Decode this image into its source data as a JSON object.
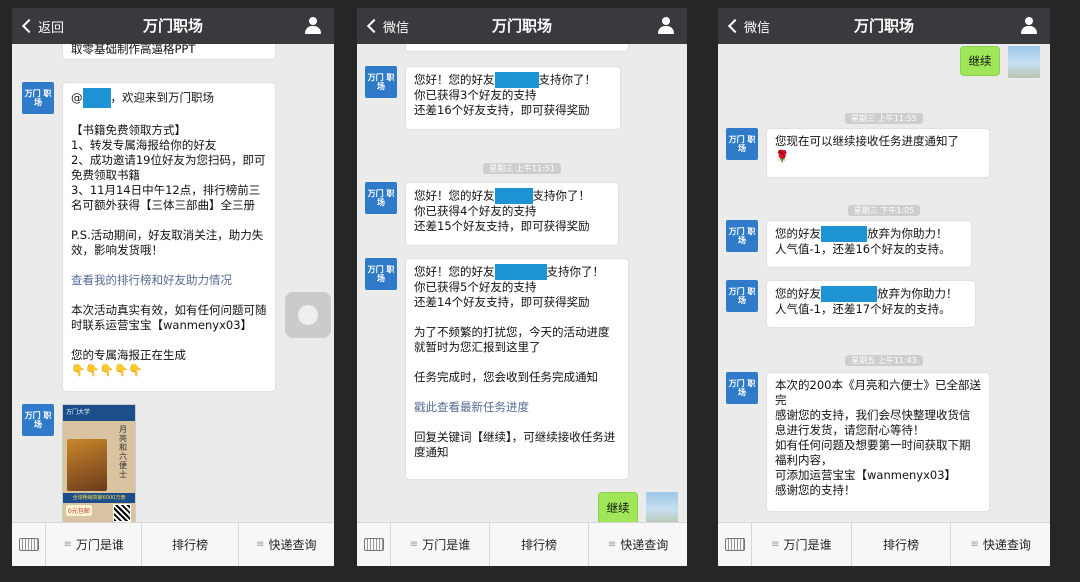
{
  "screens": [
    {
      "back_label": "返回",
      "title": "万门职场",
      "avatar_text": "万门 职场",
      "top_line": "取零基础制作高逼格PPT",
      "welcome_prefix": "@",
      "welcome_suffix": "，欢迎来到万门职场",
      "rules": "【书籍免费领取方式】\n1、转发专属海报给你的好友\n2、成功邀请19位好友为您扫码，即可免费领取书籍\n3、11月14日中午12点，排行榜前三名可额外获得【三体三部曲】全三册\n\nP.S.活动期间，好友取消关注，助力失效，影响发货哦！",
      "rank_link": "查看我的排行榜和好友助力情况",
      "contact": "本次活动真实有效，如有任何问题可随时联系运营宝宝【wanmenyx03】",
      "poster_generating": "您的专属海报正在生成",
      "emoji_row": "👇👇👇👇👇",
      "poster": {
        "brand": "万门大学",
        "book_title": "月亮和六便士",
        "badge": "全球畅销突破6000万册",
        "price": "0元包邮"
      }
    },
    {
      "back_label": "微信",
      "title": "万门职场",
      "avatar_text": "万门 职场",
      "msg1_prefix": "您好！您的好友",
      "msg1_suffix": "支持你了！",
      "msg1_rest": "你已获得3个好友的支持\n还差16个好友支持，即可获得奖励",
      "timestamp": "星期三 上午11:51",
      "msg2_prefix": "您好！您的好友",
      "msg2_suffix": "支持你了！",
      "msg2_rest": "你已获得4个好友的支持\n还差15个好友支持，即可获得奖励",
      "msg3_prefix": "您好！您的好友",
      "msg3_suffix": "支持你了！",
      "msg3_rest": "你已获得5个好友的支持\n还差14个好友支持，即可获得奖励\n\n为了不频繁的打扰您，今天的活动进度就暂时为您汇报到这里了\n\n任务完成时，您会收到任务完成通知",
      "progress_link": "戳此查看最新任务进度",
      "keyword_hint": "回复关键词【继续】，可继续接收任务进度通知",
      "user_msg": "继续"
    },
    {
      "back_label": "微信",
      "title": "万门职场",
      "avatar_text": "万门 职场",
      "user_msg": "继续",
      "ts1": "星期三 上午11:55",
      "msg1": "您现在可以继续接收任务进度通知了",
      "msg1_emoji": "🌹",
      "ts2": "星期三 下午1:05",
      "msg2_prefix": "您的好友",
      "msg2_suffix": "放弃为你助力！",
      "msg2_rest": "人气值-1，还差16个好友的支持。",
      "msg3_prefix": "您的好友",
      "msg3_suffix": "放弃为你助力！",
      "msg3_rest": "人气值-1，还差17个好友的支持。",
      "ts3": "星期五 上午11:43",
      "msg4": "本次的200本《月亮和六便士》已全部送完\n感谢您的支持，我们会尽快整理收货信息进行发货，请您耐心等待！\n如有任何问题及想要第一时间获取下期福利内容，\n可添加运营宝宝【wanmenyx03】\n感谢您的支持！"
    }
  ],
  "toolbar": {
    "item1": "万门是谁",
    "item2": "排行榜",
    "item3": "快递查询"
  },
  "colors": {
    "navbar": "#3a3a3e",
    "chat_bg": "#ebebeb",
    "avatar": "#2f7bc9",
    "user_bubble": "#9fe658",
    "link": "#576b95",
    "redaction": "#1e93d4"
  },
  "icons": [
    "back-chevron-icon",
    "user-profile-icon",
    "keyboard-icon",
    "menu-lines-icon"
  ]
}
